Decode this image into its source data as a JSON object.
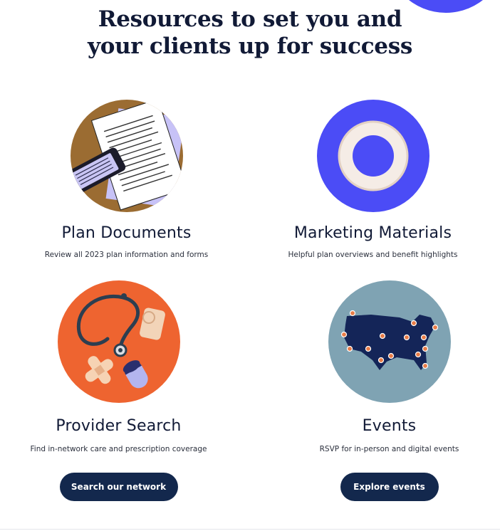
{
  "headline": {
    "line1": "Resources to set you and",
    "line2": "your clients up for success"
  },
  "cards": [
    {
      "title": "Plan Documents",
      "description": "Review all 2023 plan information and forms",
      "icon": "documents-phone-icon"
    },
    {
      "title": "Marketing Materials",
      "description": "Helpful plan overviews and benefit highlights",
      "icon": "ring-icon"
    },
    {
      "title": "Provider Search",
      "description": "Find in-network care and prescription coverage",
      "icon": "medical-supplies-icon",
      "button": "Search our network"
    },
    {
      "title": "Events",
      "description": "RSVP for in-person and digital events",
      "icon": "us-map-pins-icon",
      "button": "Explore events"
    }
  ],
  "colors": {
    "brand_blue": "#4b4cf6",
    "navy": "#13284d",
    "orange": "#ee6430",
    "brown": "#9b6c32",
    "slate": "#7fa3b3"
  }
}
